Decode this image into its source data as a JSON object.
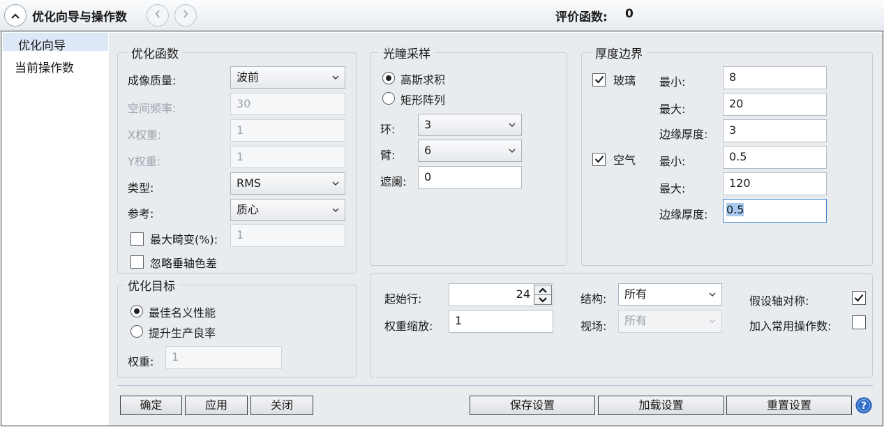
{
  "titlebar": {
    "title": "优化向导与操作数",
    "merit_label": "评价函数:",
    "merit_value": "0"
  },
  "sidebar": {
    "items": [
      {
        "label": "优化向导",
        "selected": true
      },
      {
        "label": "当前操作数",
        "selected": false
      }
    ]
  },
  "opt_function": {
    "title": "优化函数",
    "image_quality_label": "成像质量:",
    "image_quality_value": "波前",
    "spatial_freq_label": "空间频率:",
    "spatial_freq_value": "30",
    "x_weight_label": "X权重:",
    "x_weight_value": "1",
    "y_weight_label": "Y权重:",
    "y_weight_value": "1",
    "type_label": "类型:",
    "type_value": "RMS",
    "reference_label": "参考:",
    "reference_value": "质心",
    "max_distortion_label": "最大畸变(%):",
    "max_distortion_value": "1",
    "max_distortion_checked": false,
    "ignore_lateral_label": "忽略垂轴色差",
    "ignore_lateral_checked": false
  },
  "pupil_sampling": {
    "title": "光瞳采样",
    "gaussian_label": "高斯求积",
    "rect_label": "矩形阵列",
    "selected": "gaussian",
    "rings_label": "环:",
    "rings_value": "3",
    "arms_label": "臂:",
    "arms_value": "6",
    "obscuration_label": "遮阑:",
    "obscuration_value": "0"
  },
  "thickness": {
    "title": "厚度边界",
    "glass_label": "玻璃",
    "glass_checked": true,
    "air_label": "空气",
    "air_checked": true,
    "min_label": "最小:",
    "max_label": "最大:",
    "edge_label": "边缘厚度:",
    "glass_min": "8",
    "glass_max": "20",
    "glass_edge": "3",
    "air_min": "0.5",
    "air_max": "120",
    "air_edge": "0.5"
  },
  "opt_goal": {
    "title": "优化目标",
    "best_nominal_label": "最佳名义性能",
    "improve_yield_label": "提升生产良率",
    "selected": "best_nominal",
    "weight_label": "权重:",
    "weight_value": "1"
  },
  "operands": {
    "start_row_label": "起始行:",
    "start_row_value": "24",
    "weight_scale_label": "权重缩放:",
    "weight_scale_value": "1",
    "structure_label": "结构:",
    "structure_value": "所有",
    "field_label": "视场:",
    "field_value": "所有",
    "assume_symmetry_label": "假设轴对称:",
    "assume_symmetry_checked": true,
    "add_common_label": "加入常用操作数:",
    "add_common_checked": false
  },
  "buttons": {
    "ok": "确定",
    "apply": "应用",
    "close": "关闭",
    "save": "保存设置",
    "load": "加载设置",
    "reset": "重置设置"
  },
  "icons": {
    "collapse": "chevron-up-icon",
    "back": "chevron-left-icon",
    "forward": "chevron-right-icon",
    "help": "help-icon"
  },
  "colors": {
    "selection": "#dde8f6",
    "panel": "#e9ecef",
    "help_blue": "#2f6fc9",
    "text_highlight": "#a8cbef"
  }
}
